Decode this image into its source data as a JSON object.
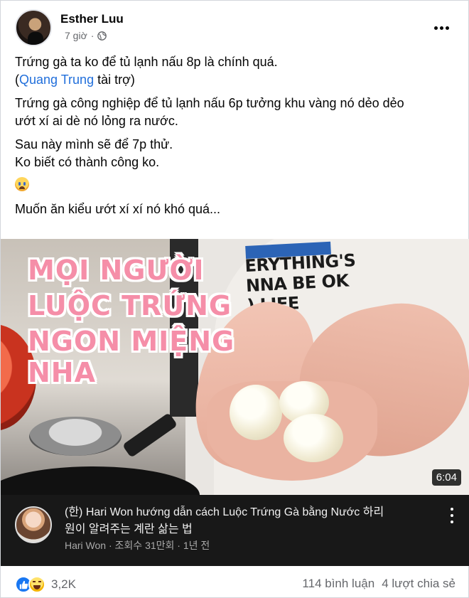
{
  "post": {
    "author": "Esther Luu",
    "time": "7 giờ",
    "privacy_icon": "globe-icon",
    "paragraphs": {
      "p1_line1": "Trứng gà ta ko để tủ lạnh nấu 8p là chính quá.",
      "p1_open": "(",
      "p1_link": "Quang Trung",
      "p1_close": " tài trợ)",
      "p2_line1": "Trứng gà công nghiệp để tủ lạnh nấu 6p tưởng khu vàng nó dẻo dẻo",
      "p2_line2": "ướt xí ai dè nó lỏng ra nước.",
      "p3_line1": "Sau này mình sẽ để 7p thử.",
      "p3_line2": "Ko biết có thành công ko.",
      "emoji": "crying-face-emoji",
      "p4": "Muốn ăn kiểu ướt xí xí nó khó quá..."
    }
  },
  "video": {
    "caption_line1": "MỌI NGƯỜI",
    "caption_line2": "LUỘC TRỨNG",
    "caption_line3": "NGON MIỆNG NHA",
    "shirt_line1": "ERYTHING'S",
    "shirt_line2": "NNA BE OK",
    "shirt_line3": ") LIFE",
    "duration": "6:04",
    "title_line1": "(한) Hari Won hướng dẫn cách Luộc Trứng Gà bằng Nước 하리",
    "title_line2": "원이 알려주는 계란 삶는 법",
    "channel_info": "Hari Won · 조회수 31만회 · 1년 전"
  },
  "footer": {
    "reaction_icons": [
      "like-icon",
      "haha-icon"
    ],
    "reaction_count": "3,2K",
    "comments": "114 bình luận",
    "shares": "4 lượt chia sẻ"
  },
  "colors": {
    "link": "#216fdb",
    "like": "#1877f2",
    "caption_pink": "#f58ea8",
    "yt_bar": "#181818"
  }
}
